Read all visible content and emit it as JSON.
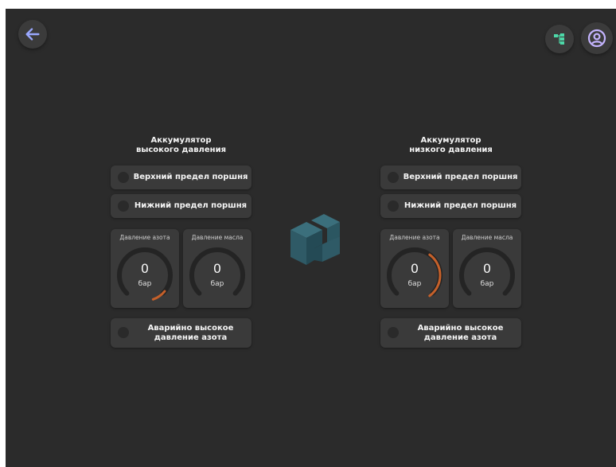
{
  "header": {
    "back_icon": "arrow-left-icon",
    "tree_icon": "hierarchy-icon",
    "user_icon": "user-circle-icon"
  },
  "colors": {
    "background": "#2b2b2b",
    "card": "#3a3a3a",
    "accent": "#9aa8ff",
    "gauge_fill": "#c5602a",
    "tree_icon": "#4dd8a8",
    "user_icon": "#c4b4ff"
  },
  "high_pressure": {
    "title_line1": "Аккумулятор",
    "title_line2": "высокого давления",
    "upper_limit": "Верхний предел поршня",
    "lower_limit": "Нижний предел поршня",
    "nitrogen_label": "Давление азота",
    "nitrogen_value": "0",
    "nitrogen_unit": "бар",
    "nitrogen_level": 0.12,
    "oil_label": "Давление масла",
    "oil_value": "0",
    "oil_unit": "бар",
    "oil_level": 0,
    "alarm_line1": "Аварийно высокое",
    "alarm_line2": "давление азота"
  },
  "low_pressure": {
    "title_line1": "Аккумулятор",
    "title_line2": "низкого давления",
    "upper_limit": "Верхний предел поршня",
    "lower_limit": "Нижний предел поршня",
    "nitrogen_label": "Давление азота",
    "nitrogen_value": "0",
    "nitrogen_unit": "бар",
    "nitrogen_level": 0.4,
    "oil_label": "Давление масла",
    "oil_value": "0",
    "oil_unit": "бар",
    "oil_level": 0,
    "alarm_line1": "Аварийно высокое",
    "alarm_line2": "давление азота"
  }
}
